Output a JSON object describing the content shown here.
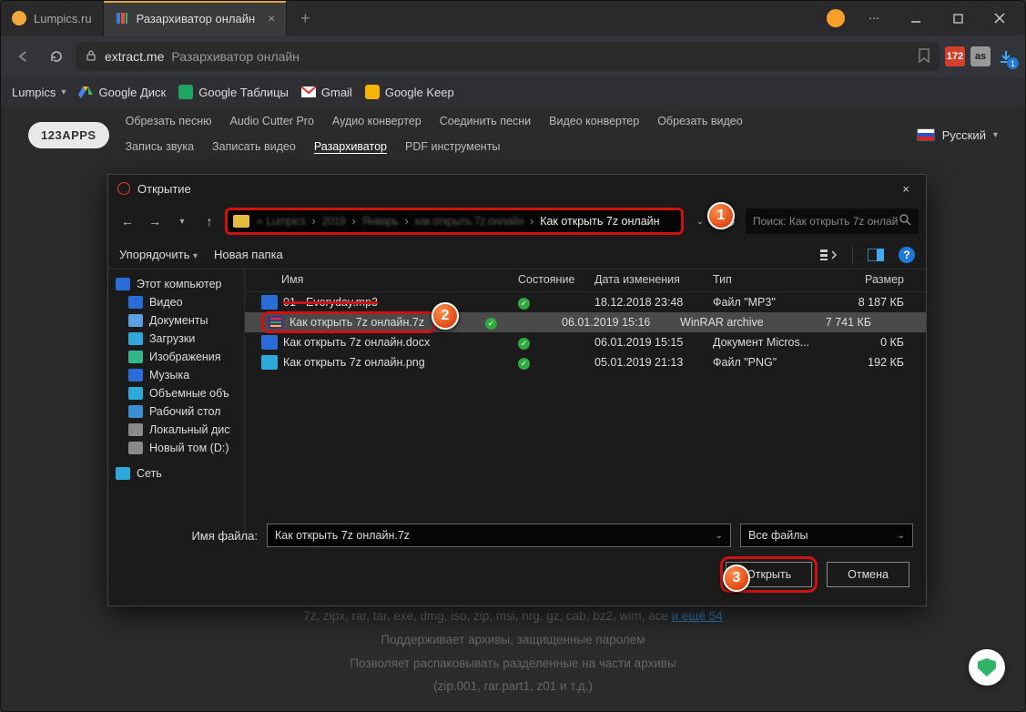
{
  "tabs": {
    "t1": {
      "label": "Lumpics.ru"
    },
    "t2": {
      "label": "Разархиватор онлайн"
    }
  },
  "address": {
    "host": "extract.me",
    "title": "Разархиватор онлайн"
  },
  "bookmarks": {
    "b0": "Lumpics",
    "b1": "Google Диск",
    "b2": "Google Таблицы",
    "b3": "Gmail",
    "b4": "Google Keep"
  },
  "appsbar": {
    "logo": "123APPS",
    "links": {
      "l0": "Обрезать песню",
      "l1": "Audio Cutter Pro",
      "l2": "Аудио конвертер",
      "l3": "Соединить песни",
      "l4": "Видео конвертер",
      "l5": "Обрезать видео",
      "l6": "Запись звука",
      "l7": "Записать видео",
      "l8": "Разархиватор",
      "l9": "PDF инструменты"
    },
    "active": "l8",
    "lang": "Русский"
  },
  "dialog": {
    "title": "Открытие",
    "path_last": "Как открыть 7z онлайн",
    "search_placeholder": "Поиск: Как открыть 7z онлай",
    "organize": "Упорядочить",
    "newfolder": "Новая папка",
    "columns": {
      "name": "Имя",
      "state": "Состояние",
      "date": "Дата изменения",
      "type": "Тип",
      "size": "Размер"
    },
    "side": {
      "pc": "Этот компьютер",
      "video": "Видео",
      "docs": "Документы",
      "down": "Загрузки",
      "img": "Изображения",
      "music": "Музыка",
      "vol": "Объемные объ",
      "desk": "Рабочий стол",
      "ldsk": "Локальный дис",
      "ddsk": "Новый том (D:)",
      "net": "Сеть"
    },
    "rows": [
      {
        "name": "01 - Everyday.mp3",
        "date": "18.12.2018 23:48",
        "type": "Файл \"MP3\"",
        "size": "8 187 КБ",
        "icon": "audio"
      },
      {
        "name": "Как открыть 7z онлайн.7z",
        "date": "06.01.2019 15:16",
        "type": "WinRAR archive",
        "size": "7 741 КБ",
        "icon": "archive",
        "selected": true
      },
      {
        "name": "Как открыть 7z онлайн.docx",
        "date": "06.01.2019 15:15",
        "type": "Документ Micros...",
        "size": "0 КБ",
        "icon": "docx"
      },
      {
        "name": "Как открыть 7z онлайн.png",
        "date": "05.01.2019 21:13",
        "type": "Файл \"PNG\"",
        "size": "192 КБ",
        "icon": "png"
      }
    ],
    "filename_label": "Имя файла:",
    "filename_value": "Как открыть 7z онлайн.7z",
    "filter": "Все файлы",
    "open": "Открыть",
    "cancel": "Отмена"
  },
  "page": {
    "formats": "7z, zipx, rar, tar, exe, dmg, iso, zip, msi, nrg, gz, cab, bz2, wim, ace",
    "more": "и ещё 54",
    "line2": "Поддерживает архивы, защищенные паролем",
    "line3": "Позволяет распаковывать разделенные на части архивы",
    "line4": "(zip.001, rar.part1, z01 и т.д.)"
  },
  "download_badge": "1",
  "ext_badge": "172",
  "callouts": {
    "c1": "1",
    "c2": "2",
    "c3": "3"
  }
}
